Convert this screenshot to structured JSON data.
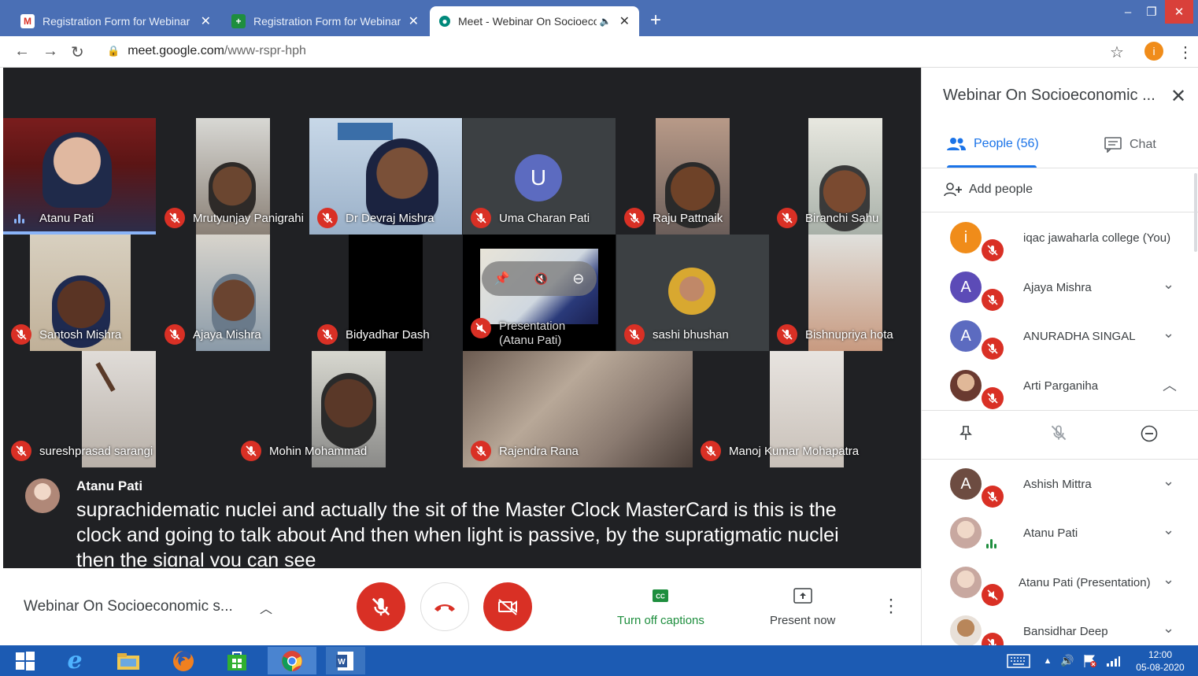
{
  "browser": {
    "tabs": [
      {
        "title": "Registration Form for Webinar o",
        "favicon": "gmail-icon"
      },
      {
        "title": "Registration Form for Webinar o",
        "favicon": "forms-icon"
      },
      {
        "title": "Meet - Webinar On Socioeco",
        "favicon": "meet-icon",
        "active": true
      }
    ],
    "url_host": "meet.google.com",
    "url_path": "/www-rspr-hph",
    "profile_initial": "i"
  },
  "tiles": [
    {
      "name": "Atanu Pati",
      "state": "speaking"
    },
    {
      "name": "Mrutyunjay Panigrahi",
      "state": "muted"
    },
    {
      "name": "Dr Devraj Mishra",
      "state": "muted"
    },
    {
      "name": "Uma Charan Pati",
      "state": "muted",
      "initial": "U"
    },
    {
      "name": "Raju Pattnaik",
      "state": "muted"
    },
    {
      "name": "Biranchi Sahu",
      "state": "muted"
    },
    {
      "name": "Santosh Mishra",
      "state": "muted"
    },
    {
      "name": "Ajaya Mishra",
      "state": "muted"
    },
    {
      "name": "Bidyadhar Dash",
      "state": "muted"
    },
    {
      "name": "Presentation (Atanu Pati)",
      "state": "muted"
    },
    {
      "name": "sashi bhushan",
      "state": "muted"
    },
    {
      "name": "Bishnupriya hota",
      "state": "muted"
    },
    {
      "name": "sureshprasad sarangi",
      "state": "muted"
    },
    {
      "name": "Mohin Mohammad",
      "state": "muted"
    },
    {
      "name": "Rajendra Rana",
      "state": "muted"
    },
    {
      "name": "Manoj Kumar Mohapatra",
      "state": "muted"
    }
  ],
  "caption": {
    "speaker": "Atanu Pati",
    "text": "suprachidematic nuclei and actually the sit of the Master Clock MasterCard is this is the clock and going to talk about And then when light is passive, by the supratigmatic nuclei then the signal you can see"
  },
  "controls": {
    "meeting_title": "Webinar On Socioeconomic s...",
    "captions_label": "Turn off captions",
    "present_label": "Present now"
  },
  "panel": {
    "title": "Webinar On Socioeconomic ...",
    "people_tab": "People (56)",
    "chat_tab": "Chat",
    "add_people": "Add people",
    "people": [
      {
        "name": "iqac jawaharla college (You)",
        "initial": "i",
        "color": "#f08c1a",
        "state": "muted"
      },
      {
        "name": "Ajaya Mishra",
        "initial": "A",
        "color": "#5c4bb7",
        "state": "muted"
      },
      {
        "name": "ANURADHA SINGAL",
        "initial": "A",
        "color": "#5c6bc0",
        "state": "muted"
      },
      {
        "name": "Arti Parganiha",
        "initial": "",
        "color": "#c9a28a",
        "state": "muted"
      },
      {
        "name": "Ashish Mittra",
        "initial": "A",
        "color": "#6d4c41",
        "state": "muted"
      },
      {
        "name": "Atanu Pati",
        "initial": "",
        "color": "#d8b8a8",
        "state": "speaking"
      },
      {
        "name": "Atanu Pati (Presentation)",
        "initial": "",
        "color": "#d8b8a8",
        "state": "muted"
      },
      {
        "name": "Bansidhar Deep",
        "initial": "",
        "color": "#c8b8a0",
        "state": "muted"
      }
    ]
  },
  "taskbar": {
    "time": "12:00",
    "date": "05-08-2020"
  }
}
